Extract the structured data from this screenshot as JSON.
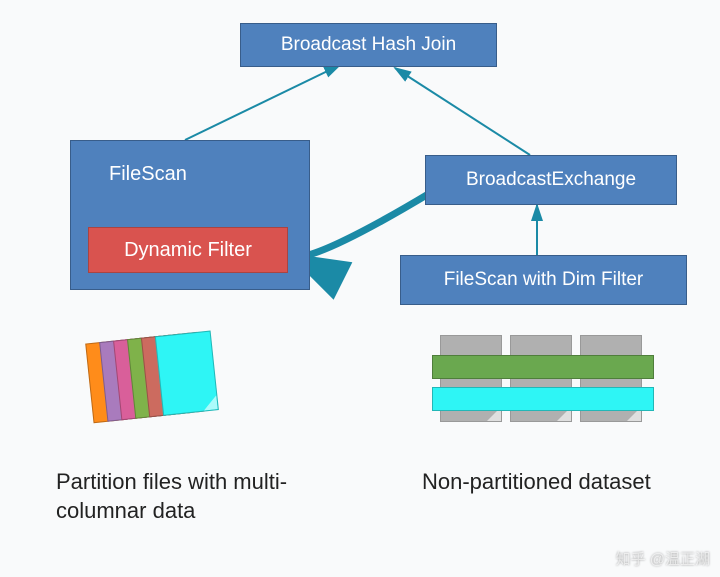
{
  "nodes": {
    "broadcast_hash_join": "Broadcast Hash Join",
    "filescan": "FileScan",
    "dynamic_filter": "Dynamic Filter",
    "broadcast_exchange": "BroadcastExchange",
    "filescan_dim_filter": "FileScan with Dim Filter"
  },
  "captions": {
    "left": "Partition files with multi-columnar data",
    "right": "Non-partitioned dataset"
  },
  "watermark": "知乎 @温正湖"
}
